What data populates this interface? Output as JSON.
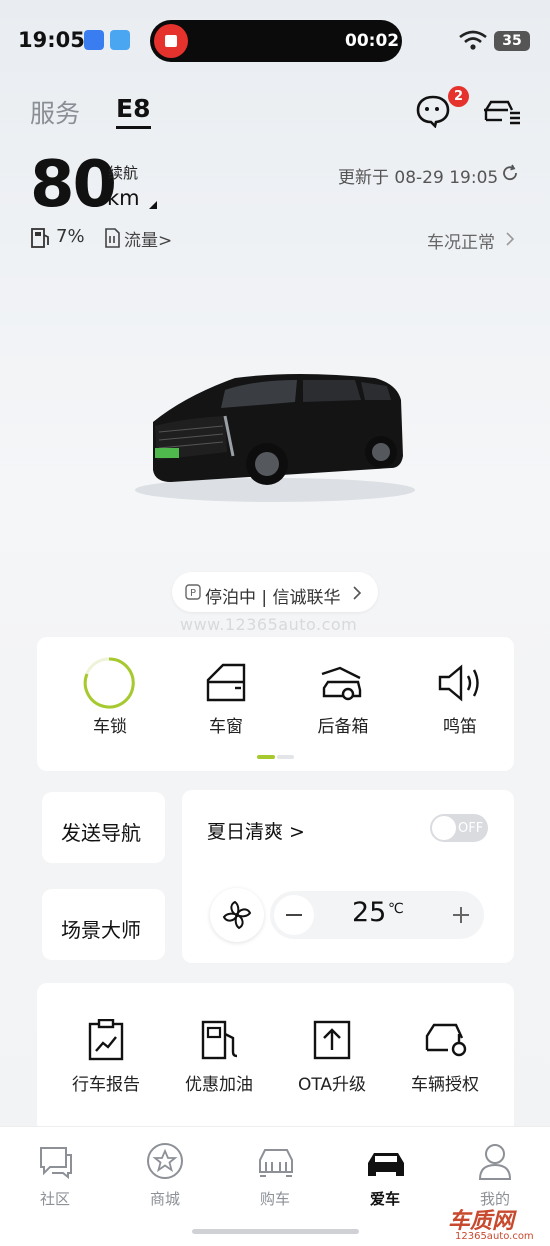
{
  "status_bar": {
    "time": "19:05",
    "recording_time": "00:02",
    "battery": "35"
  },
  "header": {
    "tabs": [
      "服务",
      "E8"
    ],
    "active_tab": "E8",
    "message_badge": "2"
  },
  "vehicle": {
    "range_value": "80",
    "range_label": "续航",
    "range_unit": "km",
    "updated": "更新于 08-29 19:05",
    "fuel_percent": "7%",
    "data_flow": "流量>",
    "status": "车况正常",
    "parking": "停泊中 | 信诚联华"
  },
  "watermark": "www.12365auto.com",
  "controls": [
    {
      "label": "车锁",
      "icon": "lock-ring-icon"
    },
    {
      "label": "车窗",
      "icon": "window-icon"
    },
    {
      "label": "后备箱",
      "icon": "trunk-icon"
    },
    {
      "label": "鸣笛",
      "icon": "horn-icon"
    }
  ],
  "shortcuts": {
    "send_navigation": "发送导航",
    "scene_master": "场景大师"
  },
  "scene": {
    "title": "夏日清爽 >",
    "toggle": "OFF",
    "temperature": "25",
    "temp_unit": "℃"
  },
  "services": [
    {
      "label": "行车报告",
      "icon": "report-icon"
    },
    {
      "label": "优惠加油",
      "icon": "fuel-pump-icon"
    },
    {
      "label": "OTA升级",
      "icon": "ota-upload-icon"
    },
    {
      "label": "车辆授权",
      "icon": "car-key-icon"
    }
  ],
  "bottom_nav": [
    {
      "label": "社区",
      "icon": "chat-bubbles-icon"
    },
    {
      "label": "商城",
      "icon": "star-circle-icon"
    },
    {
      "label": "购车",
      "icon": "car-front-icon"
    },
    {
      "label": "爱车",
      "icon": "car-solid-icon",
      "active": true
    },
    {
      "label": "我的",
      "icon": "person-icon"
    }
  ],
  "corner_logo": {
    "text": "车质网",
    "url": "12365auto.com"
  },
  "colors": {
    "accent_green": "#a6c92e",
    "record_red": "#e5322d",
    "badge_red": "#e5322d"
  }
}
